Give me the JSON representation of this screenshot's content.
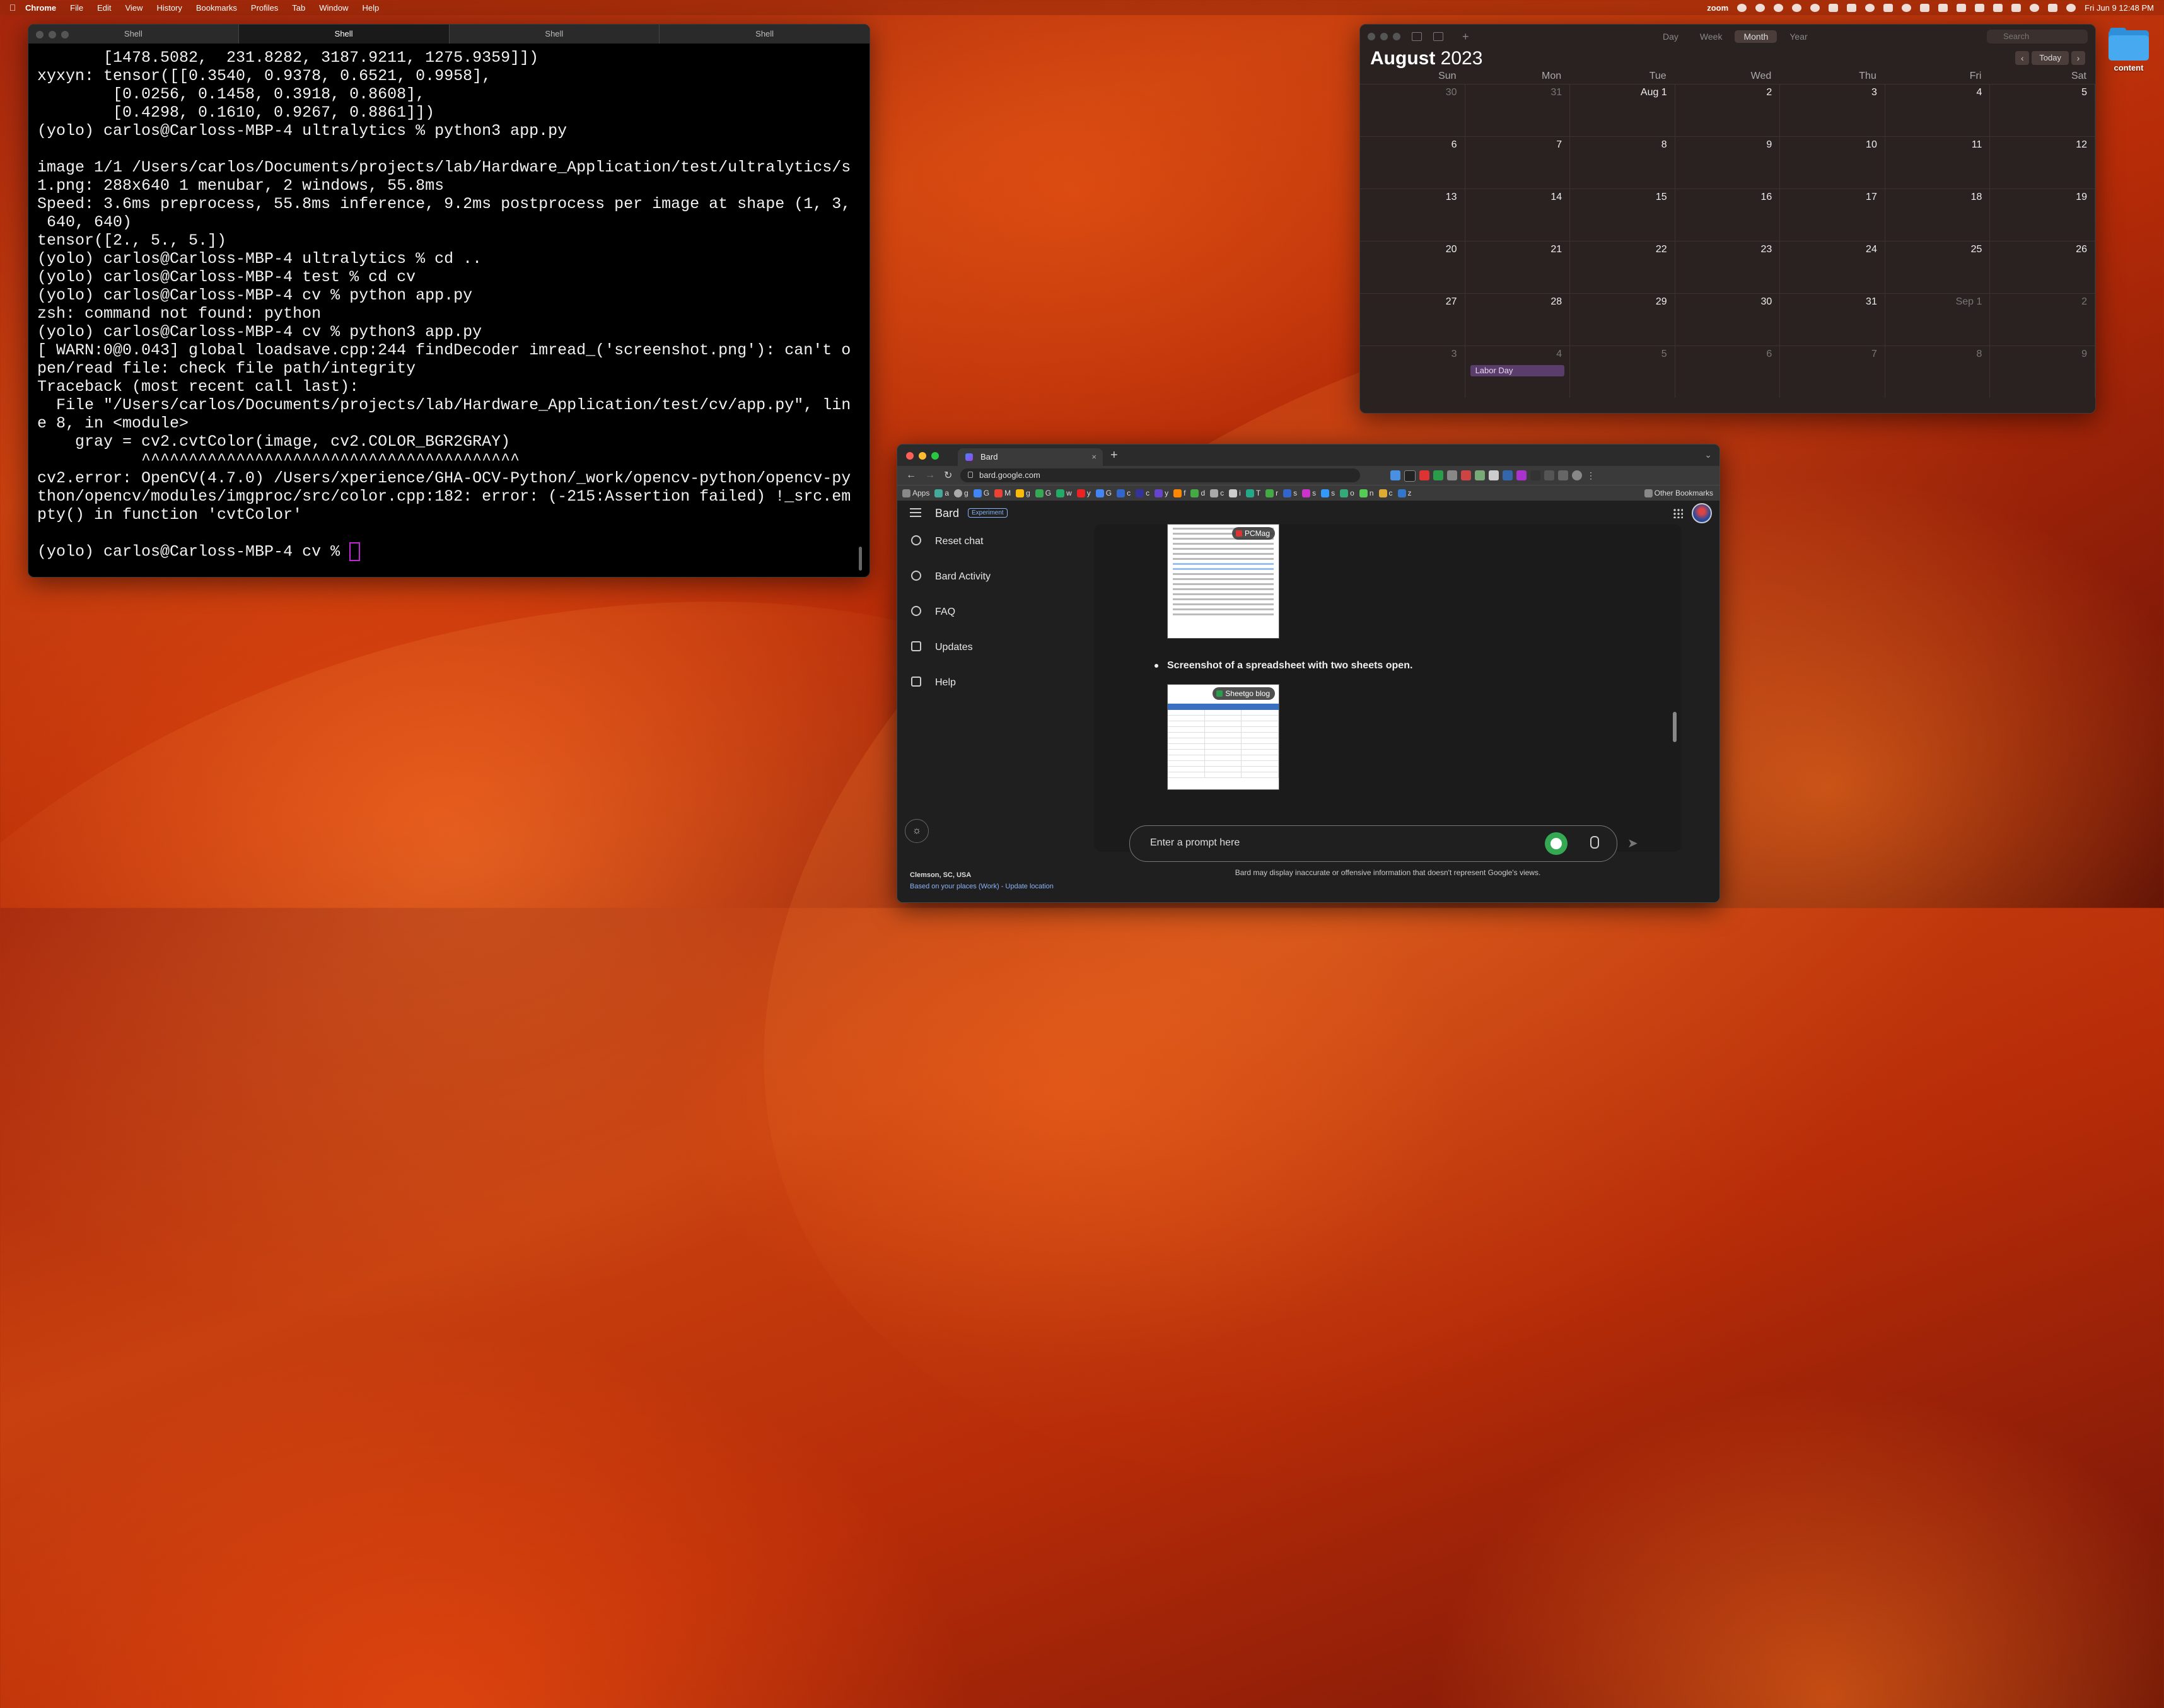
{
  "menubar": {
    "apple": "",
    "app_name": "Chrome",
    "items": [
      "File",
      "Edit",
      "View",
      "History",
      "Bookmarks",
      "Profiles",
      "Tab",
      "Window",
      "Help"
    ],
    "zoom_label": "zoom",
    "datetime": "Fri Jun 9  12:48 PM"
  },
  "terminal": {
    "tabs": [
      "Shell",
      "Shell",
      "Shell",
      "Shell"
    ],
    "lines": [
      "       [1478.5082,  231.8282, 3187.9211, 1275.9359]])",
      "xyxyn: tensor([[0.3540, 0.9378, 0.6521, 0.9958],",
      "        [0.0256, 0.1458, 0.3918, 0.8608],",
      "        [0.4298, 0.1610, 0.9267, 0.8861]])",
      "(yolo) carlos@Carloss-MBP-4 ultralytics % python3 app.py",
      "",
      "image 1/1 /Users/carlos/Documents/projects/lab/Hardware_Application/test/ultralytics/s",
      "1.png: 288x640 1 menubar, 2 windows, 55.8ms",
      "Speed: 3.6ms preprocess, 55.8ms inference, 9.2ms postprocess per image at shape (1, 3,",
      " 640, 640)",
      "tensor([2., 5., 5.])",
      "(yolo) carlos@Carloss-MBP-4 ultralytics % cd ..",
      "(yolo) carlos@Carloss-MBP-4 test % cd cv",
      "(yolo) carlos@Carloss-MBP-4 cv % python app.py",
      "zsh: command not found: python",
      "(yolo) carlos@Carloss-MBP-4 cv % python3 app.py",
      "[ WARN:0@0.043] global loadsave.cpp:244 findDecoder imread_('screenshot.png'): can't o",
      "pen/read file: check file path/integrity",
      "Traceback (most recent call last):",
      "  File \"/Users/carlos/Documents/projects/lab/Hardware_Application/test/cv/app.py\", lin",
      "e 8, in <module>",
      "    gray = cv2.cvtColor(image, cv2.COLOR_BGR2GRAY)",
      "           ^^^^^^^^^^^^^^^^^^^^^^^^^^^^^^^^^^^^^^^^",
      "cv2.error: OpenCV(4.7.0) /Users/xperience/GHA-OCV-Python/_work/opencv-python/opencv-py",
      "thon/opencv/modules/imgproc/src/color.cpp:182: error: (-215:Assertion failed) !_src.em",
      "pty() in function 'cvtColor'",
      ""
    ],
    "prompt": "(yolo) carlos@Carloss-MBP-4 cv % "
  },
  "calendar": {
    "views": [
      "Day",
      "Week",
      "Month",
      "Year"
    ],
    "active_view": "Month",
    "search_placeholder": "Search",
    "month": "August",
    "year": "2023",
    "today_label": "Today",
    "prev": "‹",
    "next": "›",
    "dows": [
      "Sun",
      "Mon",
      "Tue",
      "Wed",
      "Thu",
      "Fri",
      "Sat"
    ],
    "weeks": [
      [
        "30",
        "31",
        "Aug 1",
        "2",
        "3",
        "4",
        "5"
      ],
      [
        "6",
        "7",
        "8",
        "9",
        "10",
        "11",
        "12"
      ],
      [
        "13",
        "14",
        "15",
        "16",
        "17",
        "18",
        "19"
      ],
      [
        "20",
        "21",
        "22",
        "23",
        "24",
        "25",
        "26"
      ],
      [
        "27",
        "28",
        "29",
        "30",
        "31",
        "Sep 1",
        "2"
      ],
      [
        "3",
        "4",
        "5",
        "6",
        "7",
        "8",
        "9"
      ]
    ],
    "event": "Labor Day"
  },
  "desktop": {
    "folder_label": "content"
  },
  "browser": {
    "tab_title": "Bard",
    "tab_close": "×",
    "new_tab": "+",
    "url": "bard.google.com",
    "bookmarks": [
      "Apps",
      "a",
      "g",
      "G",
      "M",
      "g",
      "G",
      "w",
      "y",
      "G",
      "c",
      "c",
      "y",
      "f",
      "d",
      "c",
      "i",
      "T",
      "r",
      "s",
      "s",
      "s",
      "o",
      "n",
      "c",
      "z"
    ],
    "other_bookmarks": "Other Bookmarks",
    "bard": {
      "name": "Bard",
      "badge": "Experiment",
      "sidebar": [
        "Reset chat",
        "Bard Activity",
        "FAQ",
        "Updates",
        "Help"
      ],
      "location_city": "Clemson, SC, USA",
      "location_source": "Based on your places (Work)",
      "location_update": "Update location",
      "location_separator": " - ",
      "thumb1_source": "PCMag",
      "bullet": "Screenshot of a spreadsheet with two sheets open.",
      "thumb2_source": "Sheetgo blog",
      "prompt_placeholder": "Enter a prompt here",
      "disclaimer": "Bard may display inaccurate or offensive information that doesn't represent Google's views."
    }
  }
}
